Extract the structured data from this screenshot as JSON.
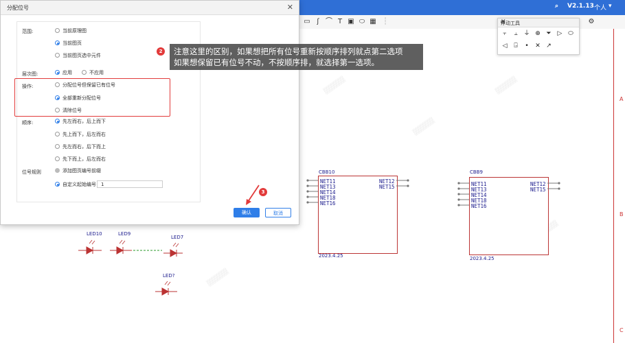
{
  "app": {
    "version": "V2.1.13",
    "user_menu": "个人"
  },
  "dialog": {
    "title": "分配位号",
    "close_icon": "close-icon",
    "scope": {
      "label": "范围:",
      "options": [
        "当前原理图",
        "当前图页",
        "当前图页选中元件"
      ],
      "selected": 1
    },
    "hierarchy": {
      "label": "层次图:",
      "options": [
        "应用",
        "不应用"
      ],
      "selected": 0
    },
    "operation": {
      "label": "操作:",
      "options": [
        "分配位号但保留已有位号",
        "全部重新分配位号",
        "清除位号"
      ],
      "selected": 1
    },
    "order": {
      "label": "顺序:",
      "options": [
        "先左而右，后上而下",
        "先上而下，后左而右",
        "先左而右，后下而上",
        "先下而上，后左而右"
      ],
      "selected": 0
    },
    "rule": {
      "label": "位号规则",
      "options": [
        "添加图页编号前缀",
        "自定义起始编号"
      ],
      "selected": 1,
      "start_value": "1"
    },
    "confirm_label": "确认",
    "cancel_label": "取消"
  },
  "annotation": {
    "badge_2": "2",
    "line1": "注意这里的区别，如果想把所有位号重新按顺序排列就点第二选项",
    "line2": "如果想保留已有位号不动，不按顺序排，就选择第一选项。",
    "badge_3": "3"
  },
  "float_tools": {
    "title": "浮动工具"
  },
  "schematic": {
    "chips": [
      {
        "name": "CBB10",
        "left_pins": [
          "NET11",
          "NET13",
          "NET14",
          "NET18",
          "NET16"
        ],
        "right_pins": [
          "NET12",
          "NET15"
        ],
        "date": "2023.4.25"
      },
      {
        "name": "CBB9",
        "left_pins": [
          "NET11",
          "NET13",
          "NET14",
          "NET18",
          "NET16"
        ],
        "right_pins": [
          "NET12",
          "NET15"
        ],
        "date": "2023.4.25"
      }
    ],
    "leds": [
      "LED10",
      "LED9",
      "LED7",
      "LED?"
    ],
    "ruler_marks": [
      "A",
      "B",
      "C"
    ]
  },
  "colors": {
    "accent": "#2f7ee8",
    "highlight": "#e23a3a",
    "schematic_text": "#1a1a8c",
    "topbar": "#2f6fd6"
  }
}
